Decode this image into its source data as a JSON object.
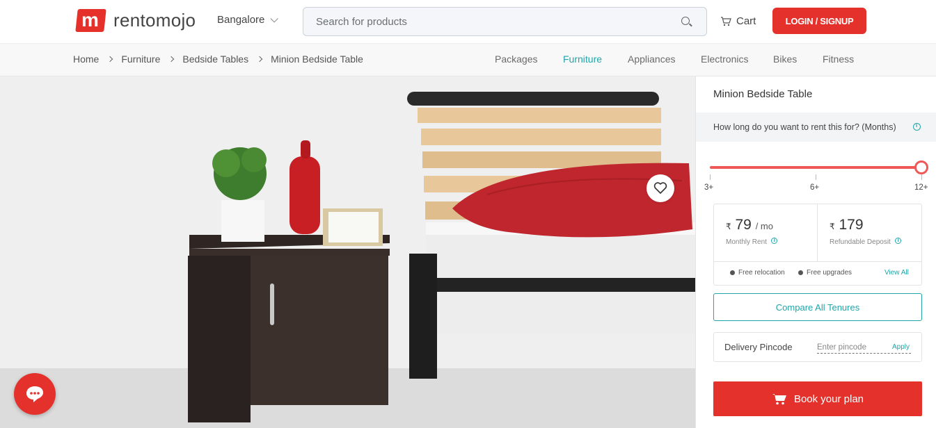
{
  "header": {
    "logo_mark": "m",
    "logo_text": "rentomojo",
    "city": "Bangalore",
    "search_placeholder": "Search for products",
    "cart_label": "Cart",
    "login_label": "LOGIN / SIGNUP"
  },
  "breadcrumb": [
    "Home",
    "Furniture",
    "Bedside Tables",
    "Minion Bedside Table"
  ],
  "categories": [
    {
      "label": "Packages",
      "active": false
    },
    {
      "label": "Furniture",
      "active": true
    },
    {
      "label": "Appliances",
      "active": false
    },
    {
      "label": "Electronics",
      "active": false
    },
    {
      "label": "Bikes",
      "active": false
    },
    {
      "label": "Fitness",
      "active": false
    }
  ],
  "product": {
    "title": "Minion Bedside Table",
    "tenure_question": "How long do you want to rent this for? (Months)",
    "tenure_options": [
      "3+",
      "6+",
      "12+"
    ],
    "tenure_selected_fraction": 1.0,
    "monthly_rent": {
      "currency": "₹",
      "value": "79",
      "unit": "/ mo",
      "label": "Monthly Rent"
    },
    "deposit": {
      "currency": "₹",
      "value": "179",
      "label": "Refundable Deposit"
    },
    "features": [
      "Free relocation",
      "Free upgrades"
    ],
    "view_all": "View All",
    "compare_label": "Compare All Tenures",
    "pincode_label": "Delivery Pincode",
    "pincode_placeholder": "Enter pincode",
    "apply_label": "Apply",
    "book_label": "Book your plan"
  },
  "colors": {
    "brand_red": "#e5312b",
    "accent_teal": "#20a5a8",
    "slider_red": "#f05858"
  }
}
